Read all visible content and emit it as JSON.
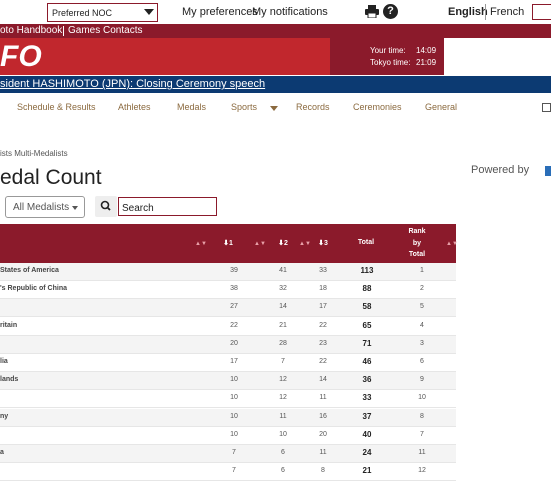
{
  "topbar": {
    "preferred_noc": "Preferred NOC",
    "my_preferences": "My preferences",
    "my_notifications": "My notifications",
    "lang_english": "English",
    "lang_french": "French"
  },
  "subheader": {
    "link1": "oto Handbook",
    "link2": "Games Contacts"
  },
  "banner": {
    "logo": "FO",
    "your_time_label": "Your time:",
    "your_time": "14:09",
    "tokyo_time_label": "Tokyo time:",
    "tokyo_time": "21:09"
  },
  "ticker": "sident HASHIMOTO (JPN): Closing Ceremony speech",
  "nav": [
    "Schedule & Results",
    "Athletes",
    "Medals",
    "Sports",
    "Records",
    "Ceremonies",
    "General"
  ],
  "breadcrumb": "ists  Multi-Medalists",
  "powered_by": "Powered by",
  "page_title": "edal Count",
  "filter": {
    "selected": "All Medalists"
  },
  "search": {
    "value": "Search"
  },
  "table": {
    "headers": {
      "gold": "1",
      "silver": "2",
      "bronze": "3",
      "total": "Total",
      "rank_line1": "Rank",
      "rank_line2": "by",
      "rank_line3": "Total"
    },
    "rows": [
      {
        "name": "States of America",
        "gold": "39",
        "silver": "41",
        "bronze": "33",
        "total": "113",
        "rank": "1"
      },
      {
        "name": "'s Republic of China",
        "gold": "38",
        "silver": "32",
        "bronze": "18",
        "total": "88",
        "rank": "2"
      },
      {
        "name": "",
        "gold": "27",
        "silver": "14",
        "bronze": "17",
        "total": "58",
        "rank": "5"
      },
      {
        "name": "ritain",
        "gold": "22",
        "silver": "21",
        "bronze": "22",
        "total": "65",
        "rank": "4"
      },
      {
        "name": "",
        "gold": "20",
        "silver": "28",
        "bronze": "23",
        "total": "71",
        "rank": "3"
      },
      {
        "name": "lia",
        "gold": "17",
        "silver": "7",
        "bronze": "22",
        "total": "46",
        "rank": "6"
      },
      {
        "name": "lands",
        "gold": "10",
        "silver": "12",
        "bronze": "14",
        "total": "36",
        "rank": "9"
      },
      {
        "name": "",
        "gold": "10",
        "silver": "12",
        "bronze": "11",
        "total": "33",
        "rank": "10"
      },
      {
        "name": "ny",
        "gold": "10",
        "silver": "11",
        "bronze": "16",
        "total": "37",
        "rank": "8"
      },
      {
        "name": "",
        "gold": "10",
        "silver": "10",
        "bronze": "20",
        "total": "40",
        "rank": "7"
      },
      {
        "name": "a",
        "gold": "7",
        "silver": "6",
        "bronze": "11",
        "total": "24",
        "rank": "11"
      },
      {
        "name": "",
        "gold": "7",
        "silver": "6",
        "bronze": "8",
        "total": "21",
        "rank": "12"
      }
    ]
  }
}
